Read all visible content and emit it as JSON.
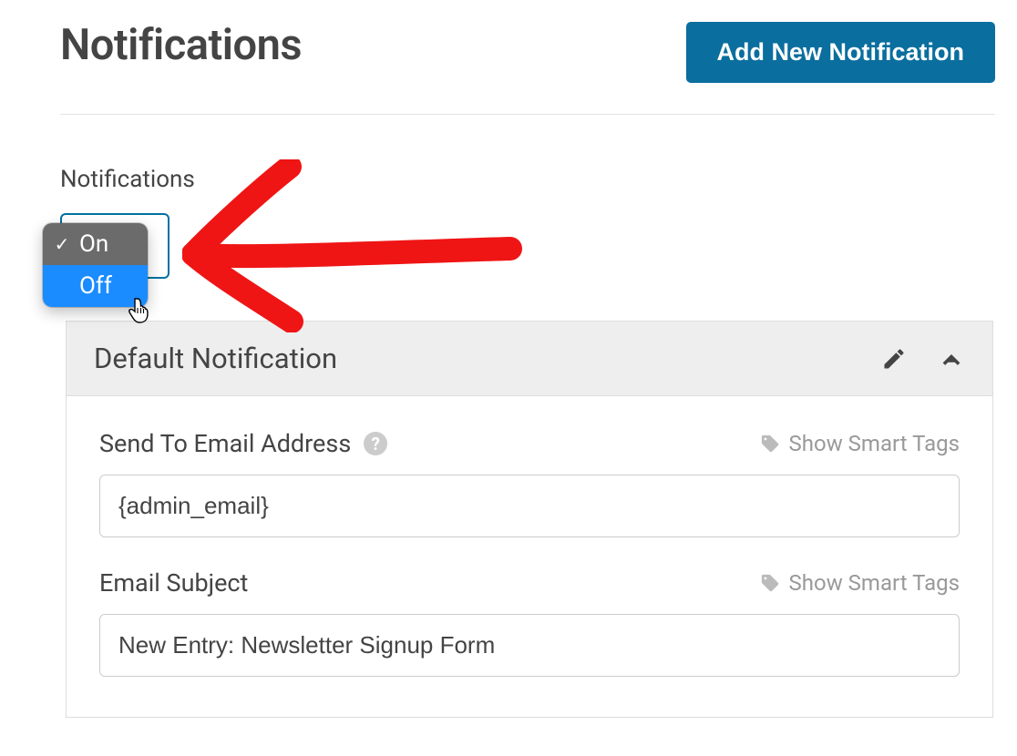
{
  "header": {
    "title": "Notifications",
    "add_button": "Add New Notification"
  },
  "toggle": {
    "section_label": "Notifications",
    "options": {
      "on": "On",
      "off": "Off"
    },
    "selected": "On",
    "hovered": "Off"
  },
  "panel": {
    "title": "Default Notification",
    "fields": {
      "send_to": {
        "label": "Send To Email Address",
        "value": "{admin_email}",
        "smart_tags_label": "Show Smart Tags"
      },
      "subject": {
        "label": "Email Subject",
        "value": "New Entry: Newsletter Signup Form",
        "smart_tags_label": "Show Smart Tags"
      }
    }
  },
  "annotation": {
    "type": "hand-drawn-arrow",
    "color": "#ef1515",
    "points_to": "toggle-dropdown"
  }
}
